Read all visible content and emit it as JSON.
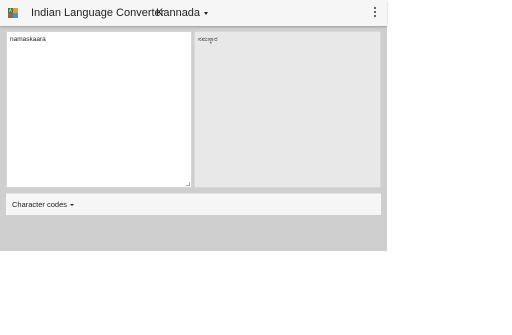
{
  "app": {
    "title": "Indian Language Converter",
    "icon": "app-logo-icon",
    "menu_icon": "more-vert-icon"
  },
  "language_select": {
    "selected": "Kannada"
  },
  "input": {
    "value": "namaskaara"
  },
  "output": {
    "value": "ನಮಸ್ಕಾರ"
  },
  "character_codes": {
    "label": "Character codes"
  },
  "colors": {
    "toolbar_bg": "#f6f6f6",
    "app_bg": "#cfcfcf",
    "output_bg": "#e8e8e8",
    "input_bg": "#ffffff"
  }
}
